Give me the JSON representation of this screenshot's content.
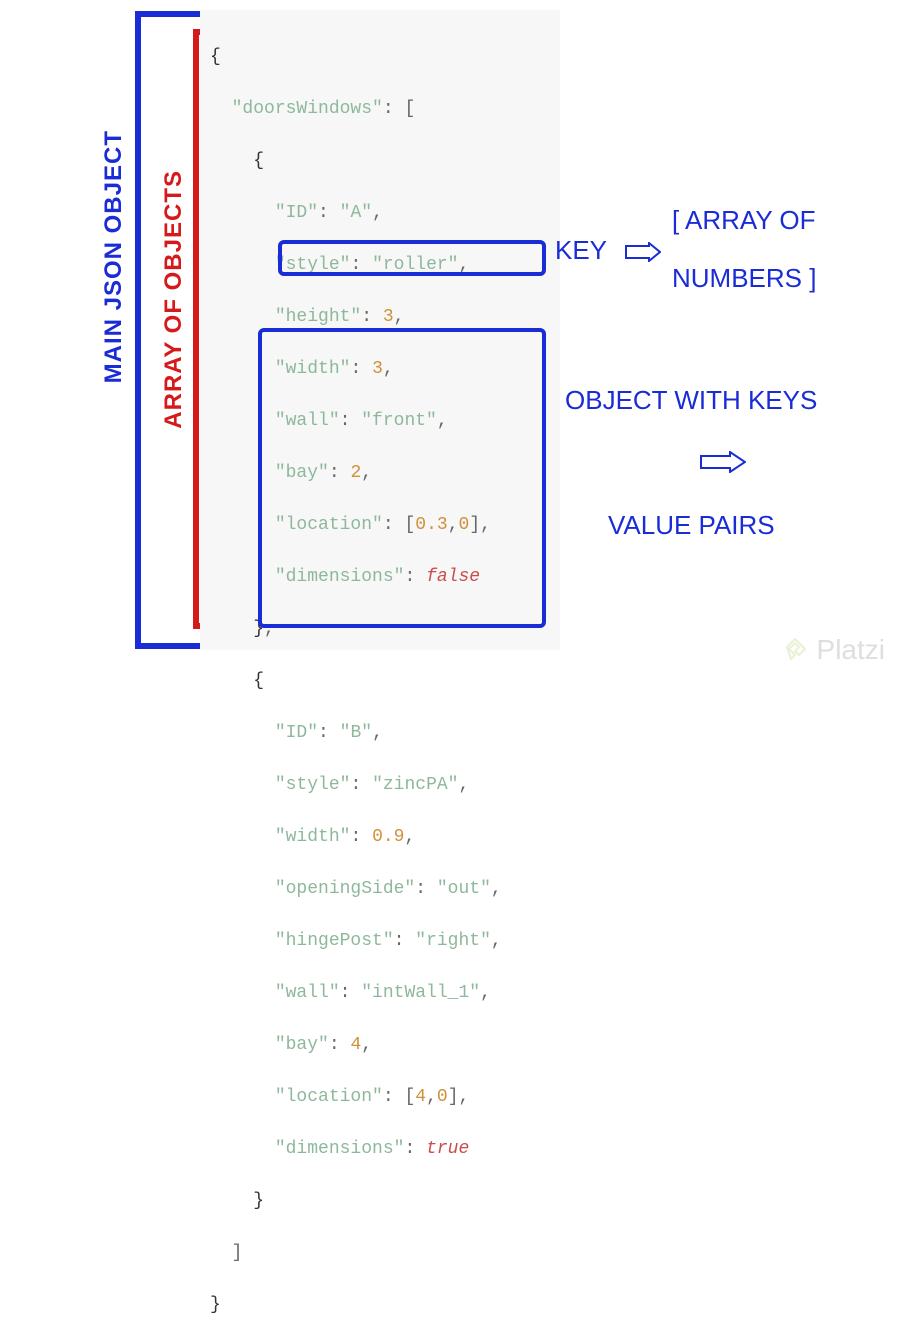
{
  "labels": {
    "main_json_object": "MAIN JSON OBJECT",
    "array_of_objects": "ARRAY OF OBJECTS",
    "key": "KEY",
    "array_of_numbers_l1": "[ ARRAY OF",
    "array_of_numbers_l2": "NUMBERS ]",
    "object_with_keys": "OBJECT WITH KEYS",
    "value_pairs": "VALUE PAIRS",
    "watermark": "Platzi"
  },
  "code": {
    "open_brace": "{",
    "close_brace": "}",
    "prop_name": "\"doorsWindows\"",
    "colon": ":",
    "open_bracket": "[",
    "close_bracket": "]",
    "obj_open": "{",
    "obj_close": "}",
    "comma": ",",
    "objA": {
      "id_k": "\"ID\"",
      "id_v": "\"A\"",
      "style_k": "\"style\"",
      "style_v": "\"roller\"",
      "height_k": "\"height\"",
      "height_v": "3",
      "width_k": "\"width\"",
      "width_v": "3",
      "wall_k": "\"wall\"",
      "wall_v": "\"front\"",
      "bay_k": "\"bay\"",
      "bay_v": "2",
      "location_k": "\"location\"",
      "loc_arr_open": "[",
      "loc_v1": "0.3",
      "loc_v2": "0",
      "loc_arr_close": "]",
      "dims_k": "\"dimensions\"",
      "dims_v": "false"
    },
    "objB": {
      "id_k": "\"ID\"",
      "id_v": "\"B\"",
      "style_k": "\"style\"",
      "style_v": "\"zincPA\"",
      "width_k": "\"width\"",
      "width_v": "0.9",
      "open_k": "\"openingSide\"",
      "open_v": "\"out\"",
      "hinge_k": "\"hingePost\"",
      "hinge_v": "\"right\"",
      "wall_k": "\"wall\"",
      "wall_v": "\"intWall_1\"",
      "bay_k": "\"bay\"",
      "bay_v": "4",
      "location_k": "\"location\"",
      "loc_arr_open": "[",
      "loc_v1": "4",
      "loc_v2": "0",
      "loc_arr_close": "]",
      "dims_k": "\"dimensions\"",
      "dims_v": "true"
    }
  }
}
